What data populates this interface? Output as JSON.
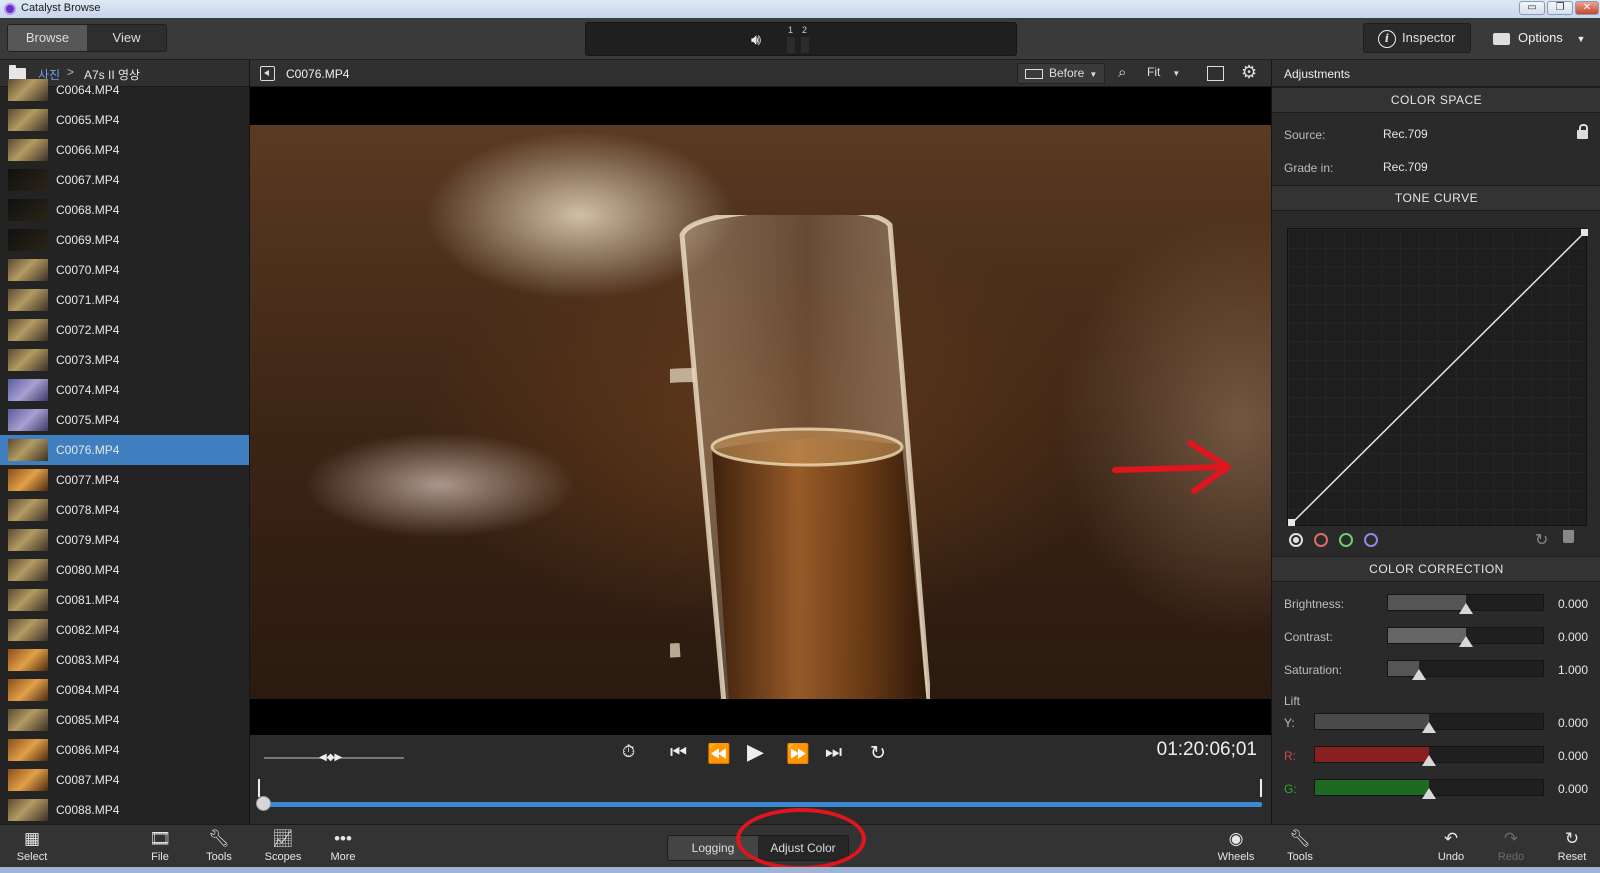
{
  "window": {
    "title": "Catalyst Browse",
    "controls": [
      "▭",
      "❐",
      "✕"
    ]
  },
  "toolbar": {
    "tabs": [
      {
        "label": "Browse",
        "active": true
      },
      {
        "label": "View",
        "active": false
      }
    ],
    "audio": {
      "channel1": "1",
      "channel2": "2"
    },
    "inspector_label": "Inspector",
    "options_label": "Options"
  },
  "breadcrumb": {
    "root": "사진",
    "separator": ">",
    "folder": "A7s II 영상"
  },
  "files": [
    {
      "name": "C0064.MP4",
      "thumb": "normal"
    },
    {
      "name": "C0065.MP4",
      "thumb": "normal"
    },
    {
      "name": "C0066.MP4",
      "thumb": "normal"
    },
    {
      "name": "C0067.MP4",
      "thumb": "dark"
    },
    {
      "name": "C0068.MP4",
      "thumb": "dark"
    },
    {
      "name": "C0069.MP4",
      "thumb": "dark"
    },
    {
      "name": "C0070.MP4",
      "thumb": "normal"
    },
    {
      "name": "C0071.MP4",
      "thumb": "normal"
    },
    {
      "name": "C0072.MP4",
      "thumb": "normal"
    },
    {
      "name": "C0073.MP4",
      "thumb": "normal"
    },
    {
      "name": "C0074.MP4",
      "thumb": "blue"
    },
    {
      "name": "C0075.MP4",
      "thumb": "blue"
    },
    {
      "name": "C0076.MP4",
      "thumb": "normal",
      "selected": true
    },
    {
      "name": "C0077.MP4",
      "thumb": "warm"
    },
    {
      "name": "C0078.MP4",
      "thumb": "normal"
    },
    {
      "name": "C0079.MP4",
      "thumb": "normal"
    },
    {
      "name": "C0080.MP4",
      "thumb": "normal"
    },
    {
      "name": "C0081.MP4",
      "thumb": "normal"
    },
    {
      "name": "C0082.MP4",
      "thumb": "normal"
    },
    {
      "name": "C0083.MP4",
      "thumb": "warm"
    },
    {
      "name": "C0084.MP4",
      "thumb": "warm"
    },
    {
      "name": "C0085.MP4",
      "thumb": "normal"
    },
    {
      "name": "C0086.MP4",
      "thumb": "warm"
    },
    {
      "name": "C0087.MP4",
      "thumb": "warm"
    },
    {
      "name": "C0088.MP4",
      "thumb": "normal"
    }
  ],
  "viewer": {
    "clip_name": "C0076.MP4",
    "before_label": "Before",
    "zoom_label": "Fit",
    "timecode": "01:20:06;01"
  },
  "adjustments": {
    "title": "Adjustments",
    "color_space": {
      "title": "COLOR SPACE",
      "source_label": "Source:",
      "source_value": "Rec.709",
      "grade_label": "Grade in:",
      "grade_value": "Rec.709"
    },
    "tone_curve": {
      "title": "TONE CURVE"
    },
    "color_correction": {
      "title": "COLOR CORRECTION",
      "brightness": {
        "label": "Brightness:",
        "value": "0.000",
        "level": 0.5
      },
      "contrast": {
        "label": "Contrast:",
        "value": "0.000",
        "level": 0.5
      },
      "saturation": {
        "label": "Saturation:",
        "value": "1.000",
        "level": 0.2
      },
      "lift_label": "Lift",
      "lift_y": {
        "label": "Y:",
        "value": "0.000",
        "level": 0.5
      },
      "lift_r": {
        "label": "R:",
        "value": "0.000",
        "level": 0.5
      },
      "lift_g": {
        "label": "G:",
        "value": "0.000",
        "level": 0.5
      }
    }
  },
  "bottombar": {
    "select": "Select",
    "file": "File",
    "tools": "Tools",
    "scopes": "Scopes",
    "more": "More",
    "mode_logging": "Logging",
    "mode_adjust": "Adjust Color",
    "wheels": "Wheels",
    "tools_right": "Tools",
    "undo": "Undo",
    "redo": "Redo",
    "reset": "Reset"
  },
  "colors": {
    "selection": "#3f7fc0",
    "annotation_red": "#e0151d",
    "scrub_blue": "#3a8ad8",
    "lift_red": "#8a1f1f",
    "lift_green": "#1f6a22"
  }
}
